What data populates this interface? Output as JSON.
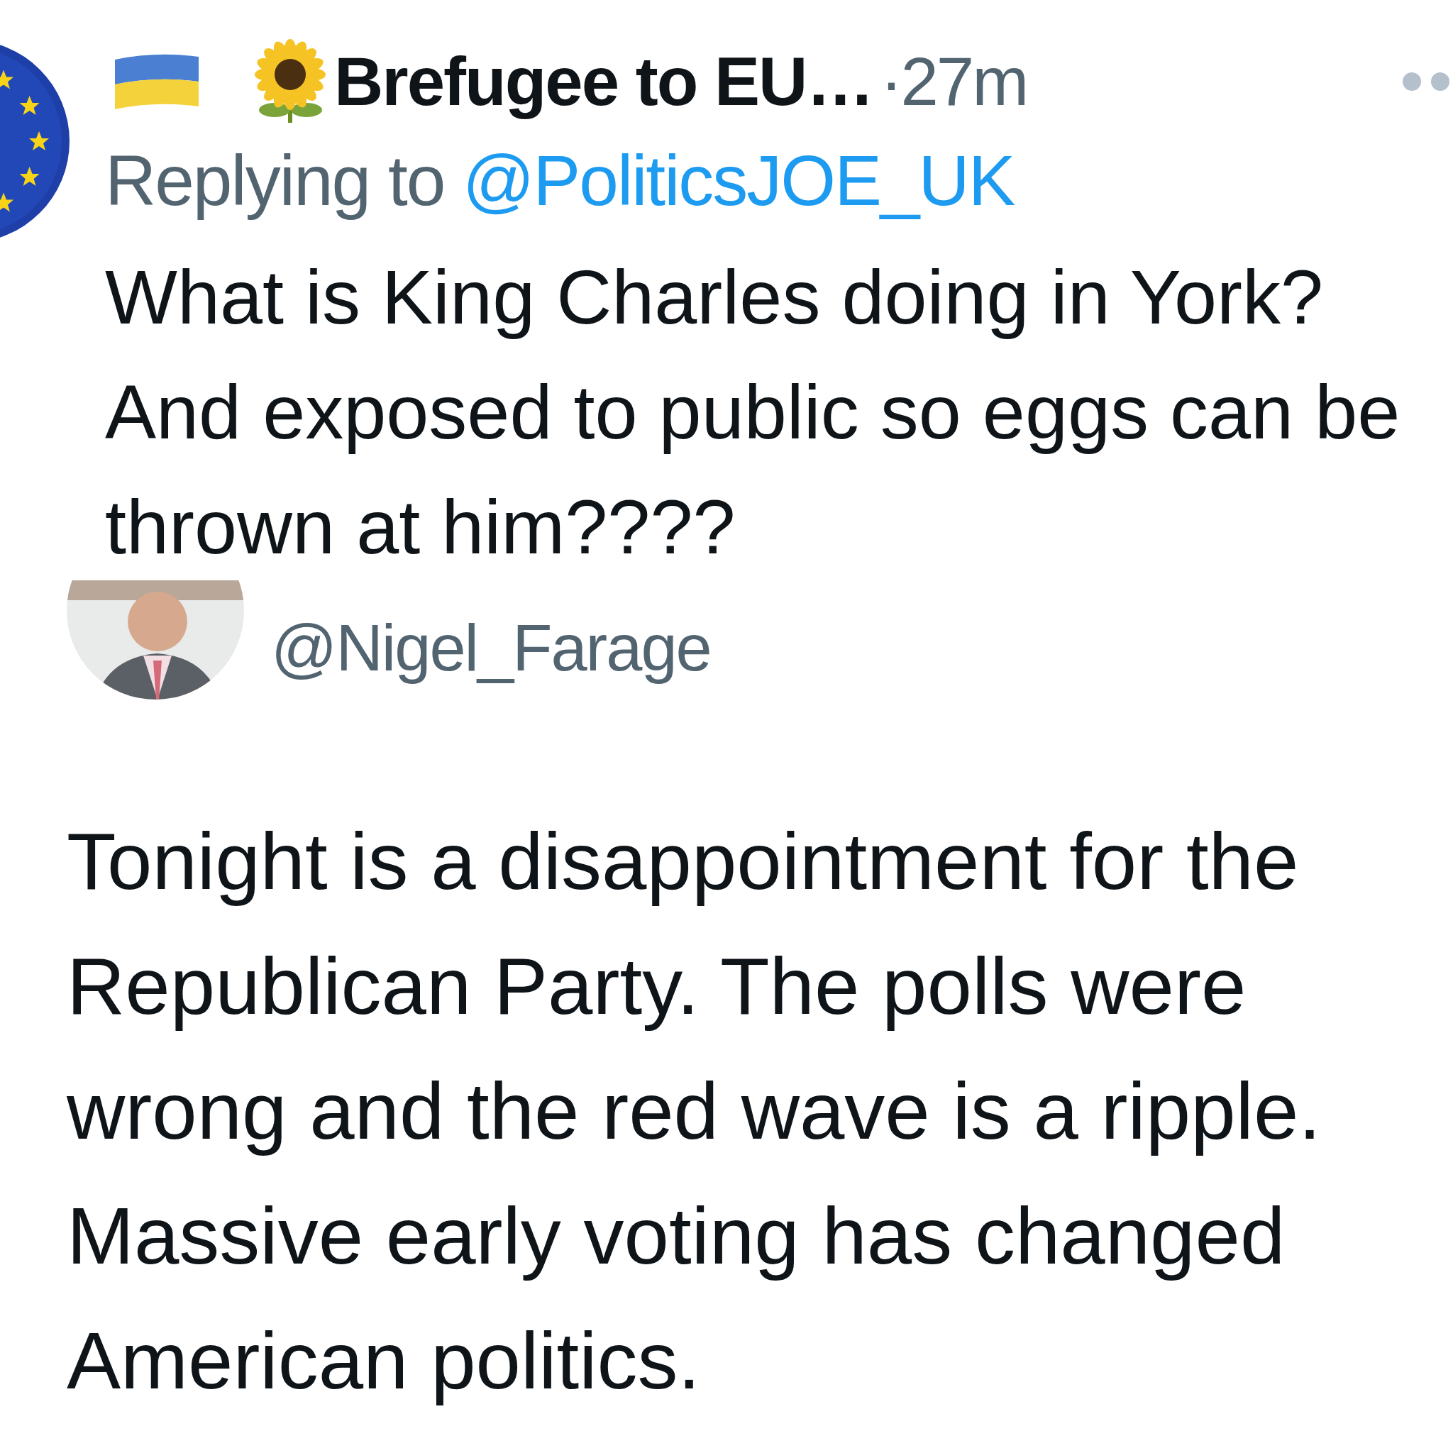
{
  "reply": {
    "author_name": "Brefugee to EU…",
    "time": "·27m",
    "replying_prefix": "Replying to",
    "replying_handle": "@PoliticsJOE_UK",
    "text": "What is King Charles doing in York? And exposed to public so eggs can be thrown at him????"
  },
  "quoted_tweet": {
    "handle": "@Nigel_Farage",
    "text": "Tonight is a disappointment for the Republican Party. The polls were wrong and the red wave is a ripple. Massive early voting has changed American politics."
  }
}
